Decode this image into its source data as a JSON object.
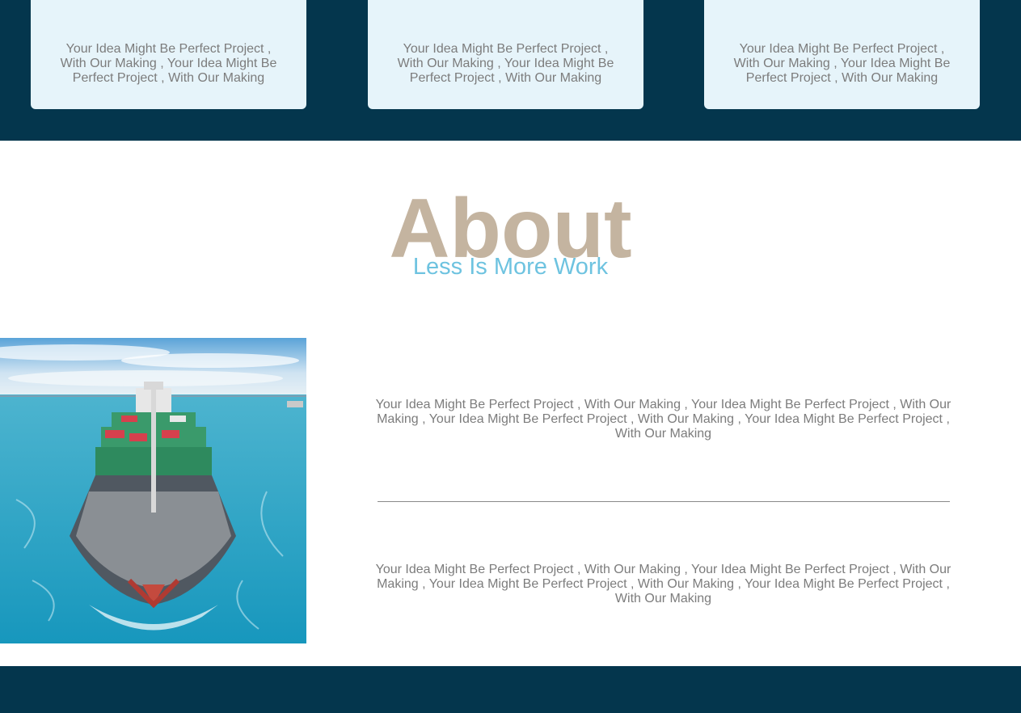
{
  "cards": [
    {
      "text": "Your Idea Might Be Perfect Project , With Our Making , Your Idea Might Be Perfect Project , With Our Making"
    },
    {
      "text": "Your Idea Might Be Perfect Project , With Our Making , Your Idea Might Be Perfect Project , With Our Making"
    },
    {
      "text": "Your Idea Might Be Perfect Project , With Our Making , Your Idea Might Be Perfect Project , With Our Making"
    }
  ],
  "about": {
    "title": "About",
    "subtitle": "Less Is More Work",
    "paragraph1": "Your Idea Might Be Perfect Project , With Our Making , Your Idea Might Be Perfect Project , With Our Making , Your Idea Might Be Perfect Project , With Our Making , Your Idea Might Be Perfect Project , With Our Making",
    "paragraph2": "Your Idea Might Be Perfect Project , With Our Making , Your Idea Might Be Perfect Project , With Our Making , Your Idea Might Be Perfect Project , With Our Making , Your Idea Might Be Perfect Project , With Our Making"
  },
  "colors": {
    "navy": "#04364d",
    "card_bg": "#e6f4fa",
    "title": "#c4b4a0",
    "subtitle": "#6ec3e0",
    "body_text": "#7c7c7c"
  }
}
